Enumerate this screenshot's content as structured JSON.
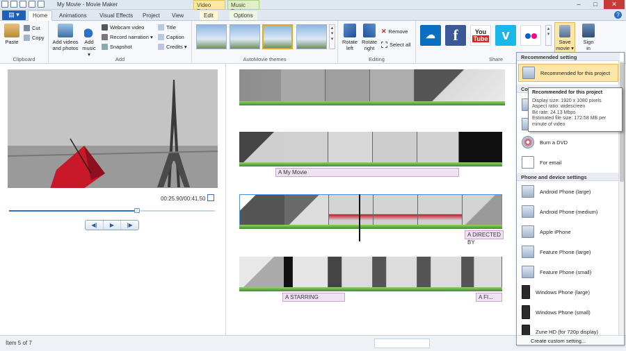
{
  "window": {
    "title": "My Movie - Movie Maker",
    "video_tools": "Video Tools",
    "music_tools": "Music Tools",
    "minimize": "–",
    "maximize": "□",
    "close": "✕"
  },
  "tabs": {
    "file": "▤ ▾",
    "home": "Home",
    "animations": "Animations",
    "visual_effects": "Visual Effects",
    "project": "Project",
    "view": "View",
    "edit": "Edit",
    "options": "Options",
    "help": "?"
  },
  "ribbon": {
    "clipboard": {
      "label": "Clipboard",
      "paste": "Paste",
      "cut": "Cut",
      "copy": "Copy"
    },
    "add": {
      "label": "Add",
      "add_videos": "Add videos",
      "and_photos": "and photos",
      "add_music": "Add",
      "music": "music ▾",
      "webcam": "Webcam video",
      "narration": "Record narration ▾",
      "snapshot": "Snapshot",
      "title": "Title",
      "caption": "Caption",
      "credits": "Credits ▾"
    },
    "themes": {
      "label": "AutoMovie themes"
    },
    "editing": {
      "label": "Editing",
      "rotate_left": "Rotate",
      "left": "left",
      "rotate_right": "Rotate",
      "right": "right",
      "remove": "Remove",
      "select_all": "Select all"
    },
    "share": {
      "label": "Share",
      "save_movie": "Save",
      "movie": "movie ▾",
      "sign_in": "Sign",
      "in": "in"
    }
  },
  "preview": {
    "timecode": "00:25.90/00:41.50",
    "progress": 0.62,
    "prev": "◀|",
    "play": "▶",
    "next": "|▶"
  },
  "storyboard": {
    "caption_my_movie": "A My Movie",
    "caption_directed_by": "A DIRECTED BY",
    "caption_starring": "A STARRING",
    "caption_fi": "A FI..."
  },
  "status": {
    "item": "Item 5 of 7"
  },
  "dropdown": {
    "recommended_header": "Recommended setting",
    "recommended_item": "Recommended for this project",
    "computer_header": "Co",
    "burn_dvd": "Burn a DVD",
    "for_email": "For email",
    "phone_header": "Phone and device settings",
    "android_large": "Android Phone (large)",
    "android_medium": "Android Phone (medium)",
    "apple_iphone": "Apple iPhone",
    "feature_large": "Feature Phone (large)",
    "feature_small": "Feature Phone (small)",
    "windows_large": "Windows Phone (large)",
    "windows_small": "Windows Phone (small)",
    "zune": "Zune HD (for 720p display)",
    "create_custom": "Create custom setting..."
  },
  "tooltip": {
    "title": "Recommended for this project",
    "display": "Display size: 1920 x 1080 pixels",
    "aspect": "Aspect ratio: widescreen",
    "bitrate": "Bit rate: 24.13 Mbps",
    "filesize": "Estimated file size: 172.58 MB per",
    "filesize2": "minute of video"
  },
  "colors": {
    "accent": "#2f6fc9",
    "highlight": "#fde7a8",
    "onedrive": "#0a6fc2",
    "facebook": "#3b5998",
    "youtube": "#e62117",
    "vimeo": "#1ab7ea",
    "flickr": "#ffffff"
  }
}
